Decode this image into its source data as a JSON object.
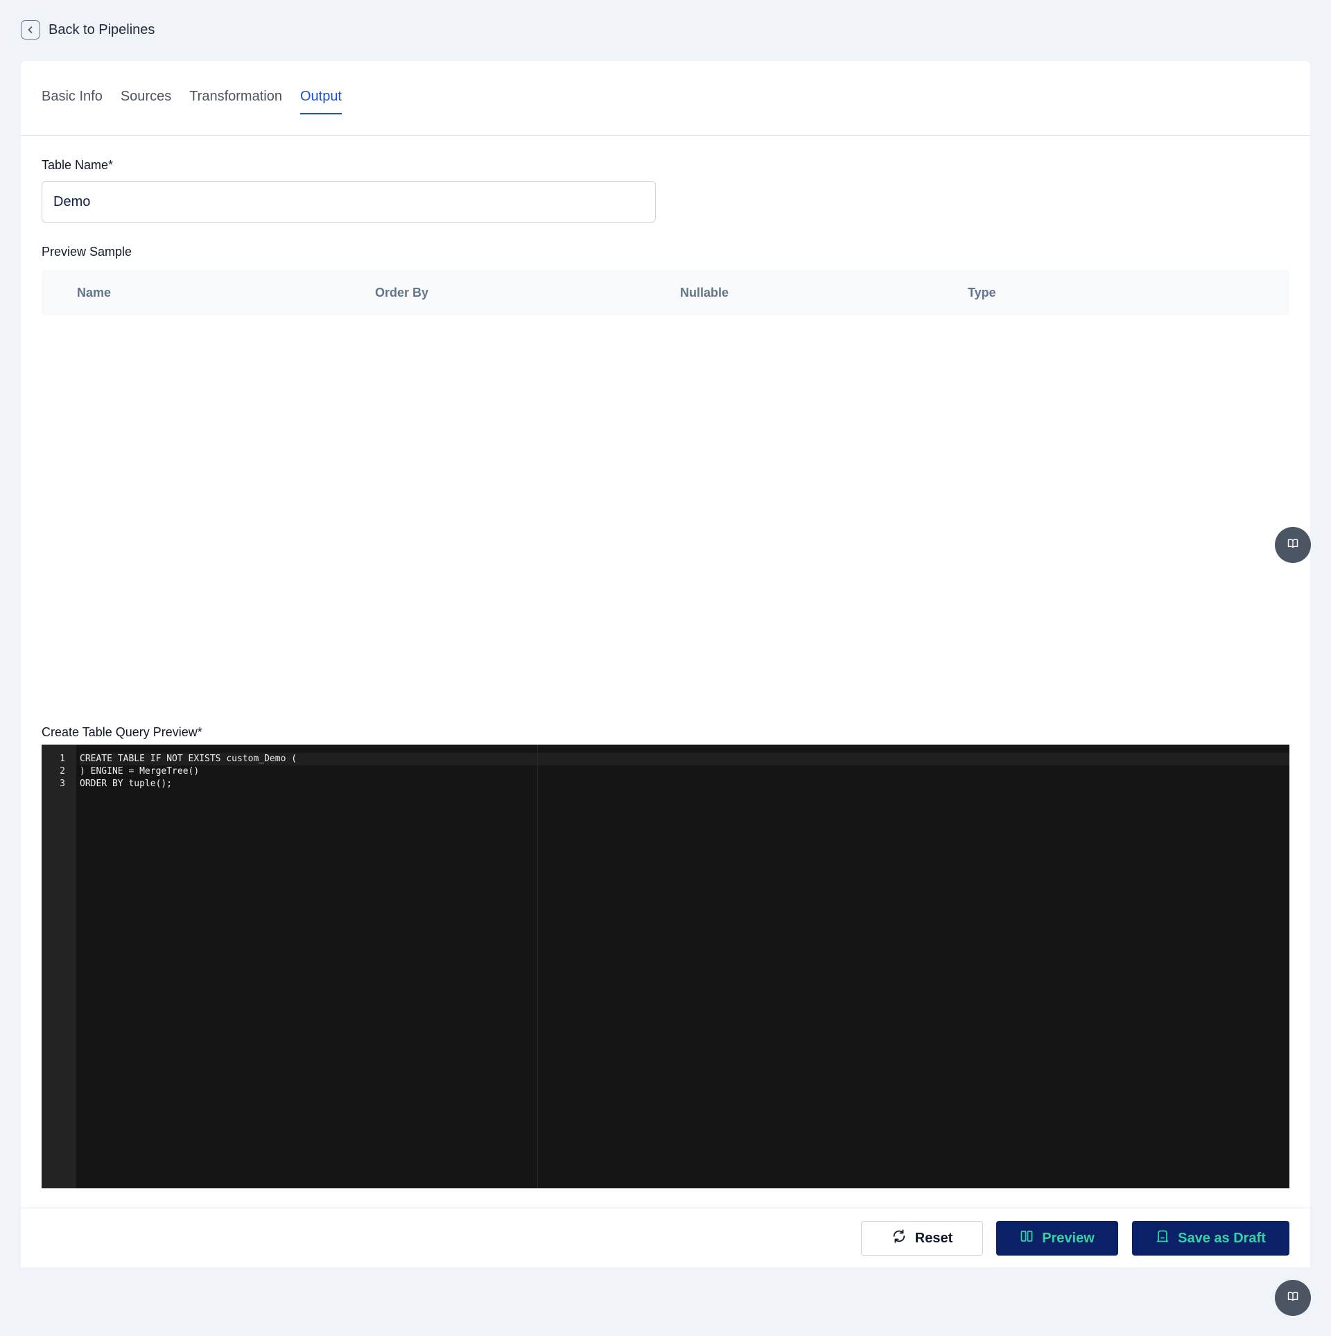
{
  "back": {
    "label": "Back to Pipelines"
  },
  "tabs": [
    {
      "label": "Basic Info"
    },
    {
      "label": "Sources"
    },
    {
      "label": "Transformation"
    },
    {
      "label": "Output"
    }
  ],
  "form": {
    "table_name_label": "Table Name*",
    "table_name_value": "Demo",
    "preview_sample_label": "Preview Sample",
    "columns": [
      "Name",
      "Order By",
      "Nullable",
      "Type"
    ],
    "query_label": "Create Table Query Preview*"
  },
  "editor": {
    "line_numbers": [
      "1",
      "2",
      "3"
    ],
    "lines": [
      "CREATE TABLE IF NOT EXISTS custom_Demo (",
      ") ENGINE = MergeTree()",
      "ORDER BY tuple();"
    ]
  },
  "footer": {
    "reset_label": "Reset",
    "preview_label": "Preview",
    "draft_label": "Save as Draft"
  },
  "colors": {
    "accent": "#1d4ed8",
    "primary_button": "#0b2167",
    "primary_button_text": "#33d3a4"
  }
}
